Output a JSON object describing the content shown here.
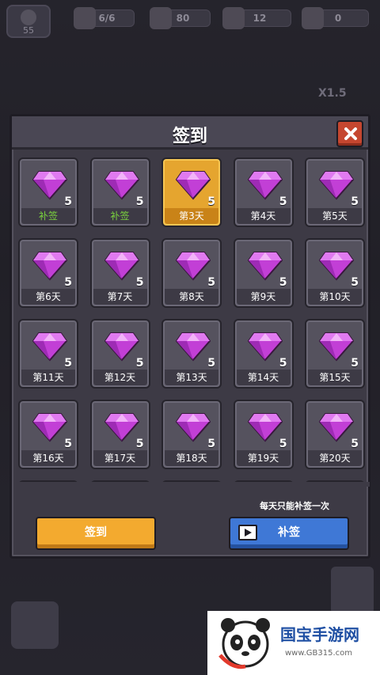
{
  "top_bar": {
    "level": "55",
    "resources": [
      {
        "icon": "box-icon",
        "value": "6/6"
      },
      {
        "icon": "meat-icon",
        "value": "80"
      },
      {
        "icon": "ticket-icon",
        "value": "12"
      },
      {
        "icon": "gem-plus-icon",
        "value": "0"
      }
    ],
    "multiplier": "X1.5"
  },
  "modal": {
    "title": "签到",
    "close_icon": "close-icon",
    "reward_icon": "purple-gem-icon",
    "cells": [
      {
        "count": "5",
        "label": "补签",
        "state": "makeup"
      },
      {
        "count": "5",
        "label": "补签",
        "state": "makeup"
      },
      {
        "count": "5",
        "label": "第3天",
        "state": "today"
      },
      {
        "count": "5",
        "label": "第4天",
        "state": "normal"
      },
      {
        "count": "5",
        "label": "第5天",
        "state": "normal"
      },
      {
        "count": "5",
        "label": "第6天",
        "state": "normal"
      },
      {
        "count": "5",
        "label": "第7天",
        "state": "normal"
      },
      {
        "count": "5",
        "label": "第8天",
        "state": "normal"
      },
      {
        "count": "5",
        "label": "第9天",
        "state": "normal"
      },
      {
        "count": "5",
        "label": "第10天",
        "state": "normal"
      },
      {
        "count": "5",
        "label": "第11天",
        "state": "normal"
      },
      {
        "count": "5",
        "label": "第12天",
        "state": "normal"
      },
      {
        "count": "5",
        "label": "第13天",
        "state": "normal"
      },
      {
        "count": "5",
        "label": "第14天",
        "state": "normal"
      },
      {
        "count": "5",
        "label": "第15天",
        "state": "normal"
      },
      {
        "count": "5",
        "label": "第16天",
        "state": "normal"
      },
      {
        "count": "5",
        "label": "第17天",
        "state": "normal"
      },
      {
        "count": "5",
        "label": "第18天",
        "state": "normal"
      },
      {
        "count": "5",
        "label": "第19天",
        "state": "normal"
      },
      {
        "count": "5",
        "label": "第20天",
        "state": "normal"
      }
    ],
    "notice": "每天只能补签一次",
    "sign_button": "签到",
    "makeup_button": "补签",
    "makeup_icon": "video-icon"
  },
  "watermark": {
    "title": "国宝手游网",
    "url": "www.GB315.com"
  },
  "colors": {
    "today": "#e5a52f",
    "makeup_label": "#7ad23e",
    "sign_button": "#f3aa2f",
    "makeup_button": "#3f78d6",
    "close_button": "#c5462f",
    "gem": "#c23fd6"
  }
}
